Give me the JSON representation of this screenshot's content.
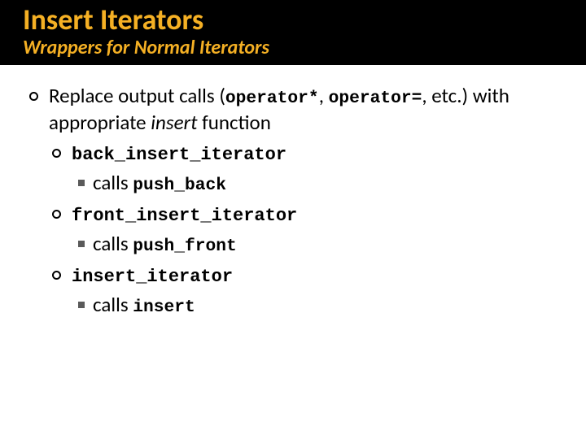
{
  "header": {
    "title": "Insert Iterators",
    "subtitle": "Wrappers for Normal Iterators"
  },
  "bullets": {
    "main": {
      "t1": "Replace output calls (",
      "c1": "operator*",
      "t2": ", ",
      "c2": "operator=",
      "t3": ", etc.) with appropriate ",
      "i1": "insert",
      "t4": " function"
    },
    "items": [
      {
        "code": "back_insert_iterator",
        "sub": {
          "pre": "calls ",
          "code": "push_back"
        }
      },
      {
        "code": "front_insert_iterator",
        "sub": {
          "pre": "calls ",
          "code": "push_front"
        }
      },
      {
        "code": "insert_iterator",
        "sub": {
          "pre": "calls ",
          "code": "insert"
        }
      }
    ]
  }
}
